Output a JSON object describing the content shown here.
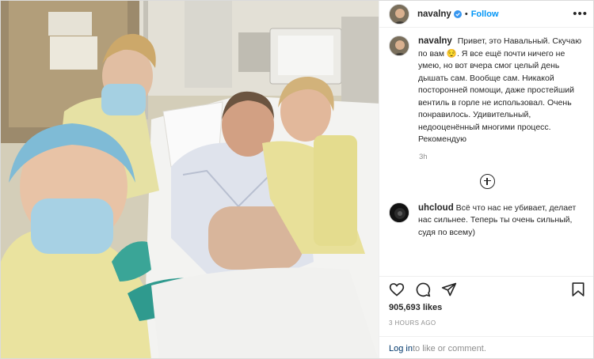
{
  "post": {
    "username": "navalny",
    "dot": "•",
    "follow_label": "Follow",
    "more_icon": "more-horizontal-icon",
    "verified_icon": "verified-badge-icon",
    "accent_color": "#0095f6"
  },
  "caption": {
    "username": "navalny",
    "text": "Привет, это Навальный. Скучаю по вам 😌. Я все ещё почти ничего не умею, но вот вчера смог целый день дышать сам. Вообще сам. Никакой посторонней помощи, даже простейший вентиль в горле не использовал. Очень понравилось. Удивительный, недооценённый многими процесс. Рекомендую",
    "time": "3h"
  },
  "comment": {
    "username": "uhcloud",
    "text": "Всё что нас не убивает, делает нас сильнее. Теперь ты очень сильный, судя по всему)"
  },
  "actions": {
    "icons": [
      "heart-icon",
      "comment-icon",
      "share-icon",
      "bookmark-icon"
    ],
    "likes": "905,693 likes",
    "posted_ago": "3 HOURS AGO"
  },
  "footer": {
    "login_link": "Log in",
    "login_rest": " to like or comment."
  }
}
